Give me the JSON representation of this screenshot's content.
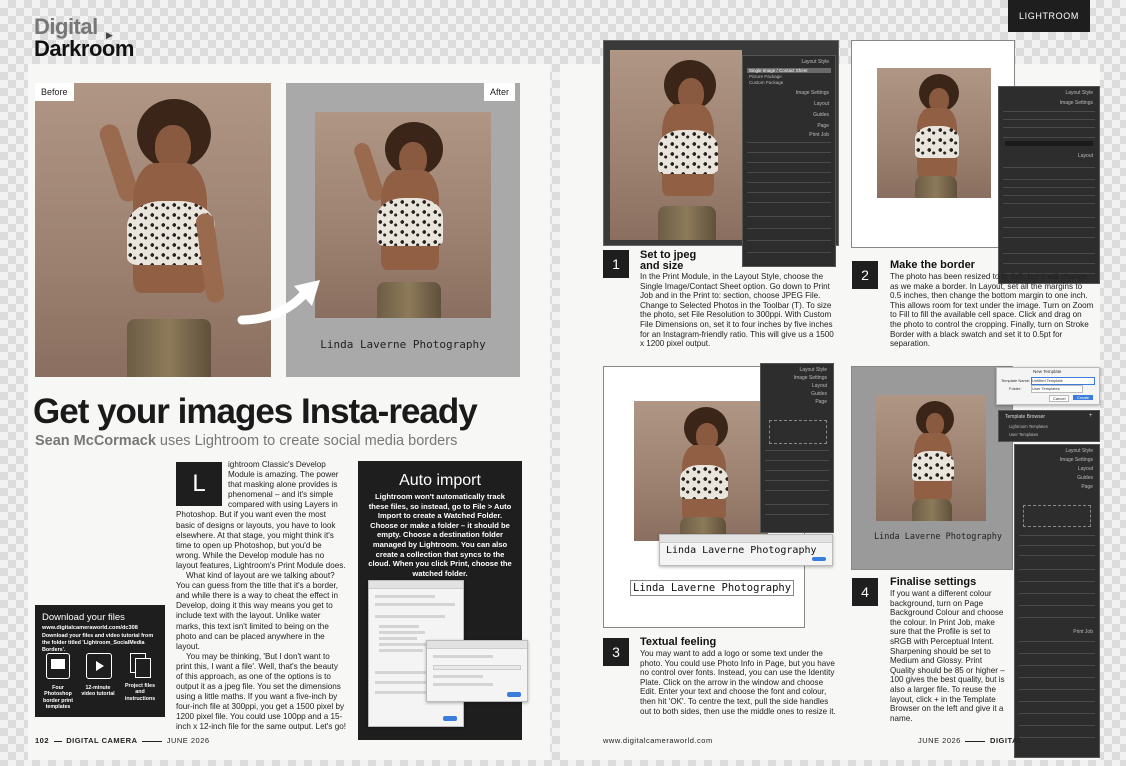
{
  "brand": {
    "line1": "Digital",
    "line2": "Darkroom"
  },
  "section_tab": "LIGHTROOM",
  "labels": {
    "before": "Before",
    "after": "After"
  },
  "watermark": "Linda Laverne Photography",
  "headline": "Get your images Insta-ready",
  "byline": {
    "author": "Sean McCormack",
    "rest": " uses Lightroom to create social media borders"
  },
  "intro": {
    "dropcap": "L",
    "text": "ightroom Classic's Develop Module is amazing. The power that masking alone provides is phenomenal – and it's simple compared with using Layers in Photoshop. But if you want even the most basic of designs or layouts, you have to look elsewhere. At that stage, you might think it's time to open up Photoshop, but you'd be wrong. While the Develop module has no layout features, Lightroom's Print Module does.",
    "p2": "What kind of layout are we talking about? You can guess from the title that it's a border, and while there is a way to cheat the effect in Develop, doing it this way means you get to include text with the layout. Unlike water marks, this text isn't limited to being on the photo and can be placed anywhere in the layout.",
    "p3": "You may be thinking, 'But I don't want to print this, I want a file'. Well, that's the beauty of this approach, as one of the options is to output it as a jpeg file. You set the dimensions using a little maths. If you want a five-inch by four-inch file at 300ppi, you get a 1500 pixel by 1200 pixel file. You could use 100pp and a 15-inch x 12-inch file for the same output. Let's go!"
  },
  "autoimport": {
    "title": "Auto import",
    "text": "Lightroom won't automatically track these files, so instead, go to File > Auto Import to create a Watched Folder. Choose or make a folder – it should be empty. Choose a destination folder managed by Lightroom. You can also create a collection that syncs to the cloud. When you click Print, choose the watched folder."
  },
  "download": {
    "title": "Download your files",
    "url": "www.digitalcameraworld.com/dc308",
    "text": "Download your files and video tutorial from the folder titled 'Lightroom_SocialMedia Borders'.",
    "items": [
      {
        "label": "Four Photoshop border print templates"
      },
      {
        "label": "12-minute video tutorial"
      },
      {
        "label": "Project files and instructions"
      }
    ]
  },
  "steps": [
    {
      "num": "1",
      "title": "Set to jpeg and size",
      "body": "In the Print Module, in the Layout Style, choose the Single Image/Contact Sheet option. Go down to Print Job and in the Print to: section, choose JPEG File. Change to Selected Photos in the Toolbar (T). To size the photo, set File Resolution to 300ppi. With Custom File Dimensions on, set it to four inches by five inches for an Instagram-friendly ratio. This will give us a 1500 x 1200 pixel output."
    },
    {
      "num": "2",
      "title": "Make the border",
      "body": "The photo has been resized to fit 4x5, but it will change as we make a border. In Layout, set all the margins to 0.5 inches, then change the bottom margin to one inch. This allows room for text under the image. Turn on Zoom to Fill to fill the available cell space. Click and drag on the photo to control the cropping. Finally, turn on Stroke Border with a black swatch and set it to 0.5pt for separation."
    },
    {
      "num": "3",
      "title": "Textual feeling",
      "body": "You may want to add a logo or some text under the photo. You could use Photo Info in Page, but you have no control over fonts. Instead, you can use the Identity Plate. Click on the arrow in the window and choose Edit. Enter your text and choose the font and colour, then hit 'OK'. To centre the text, pull the side handles out to both sides, then use the middle ones to resize it."
    },
    {
      "num": "4",
      "title": "Finalise settings",
      "body": "If you want a different colour background, turn on Page Background Colour and choose the colour. In Print Job, make sure that the Profile is set to sRGB with Perceptual Intent. Sharpening should be set to Medium and Glossy. Print Quality should be 85 or higher – 100 gives the best quality, but is also a larger file. To reuse the layout, click + in the Template Browser on the left and give it a name."
    }
  ],
  "panel_text": {
    "layout_style": "Layout Style",
    "single_image": "Single Image / Contact Sheet",
    "picture_package": "Picture Package",
    "custom_package": "Custom Package",
    "image_settings": "Image Settings",
    "layout": "Layout",
    "guides": "Guides",
    "page": "Page",
    "print_job": "Print Job",
    "new_template": "New Template",
    "template_name_label": "Template Name:",
    "template_name_value": "Untitled Template",
    "folder_label": "Folder:",
    "folder_value": "User Templates",
    "template_browser": "Template Browser",
    "lr_templates": "Lightroom Templates",
    "user_templates": "User Templates",
    "cancel": "Cancel",
    "create": "Create"
  },
  "footer": {
    "left_page": "102",
    "left_mag": "DIGITAL CAMERA",
    "left_date": "JUNE 2026",
    "url": "www.digitalcameraworld.com",
    "right_date": "JUNE 2026",
    "right_mag": "DIGITAL"
  }
}
